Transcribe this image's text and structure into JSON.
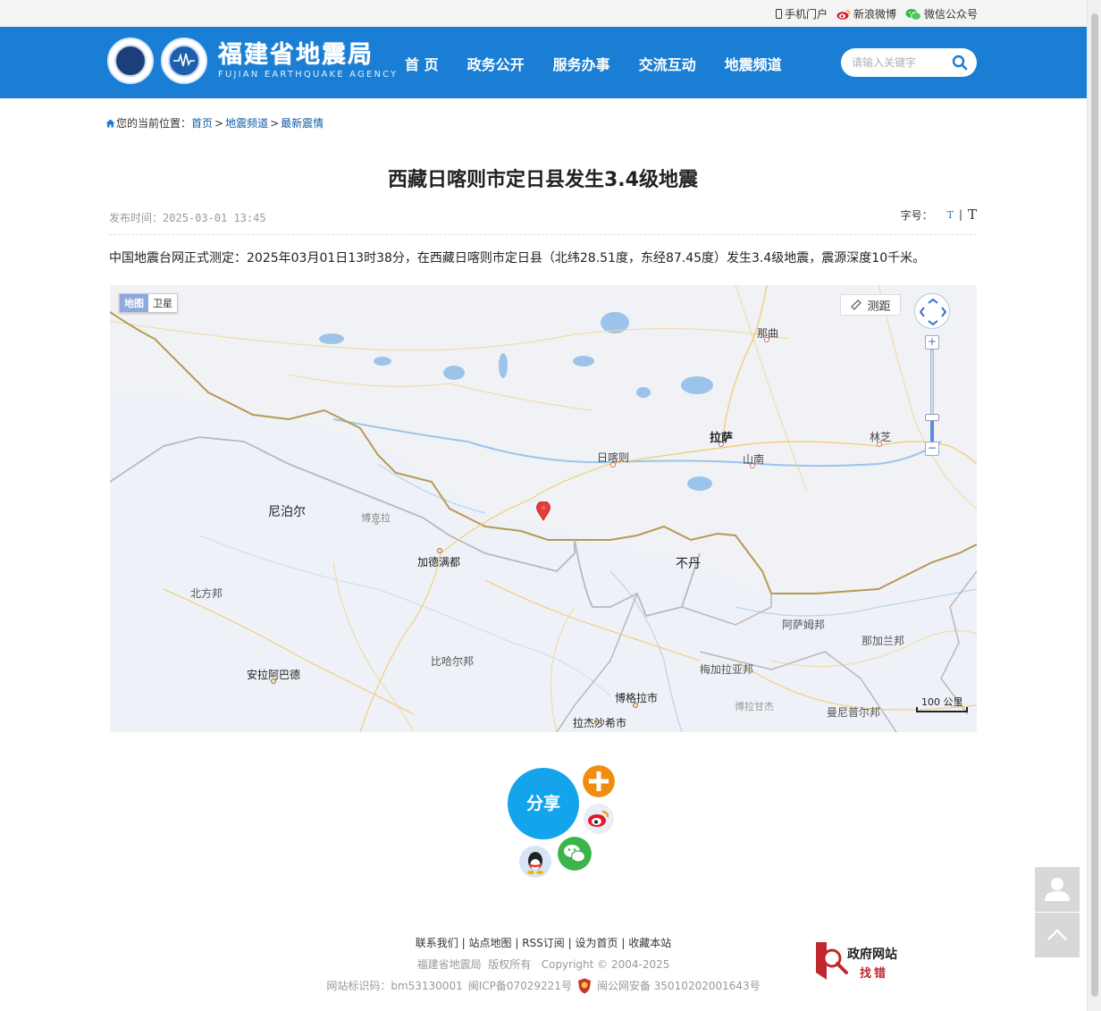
{
  "topbar": {
    "mobile": "手机门户",
    "weibo": "新浪微博",
    "wechat": "微信公众号"
  },
  "header": {
    "logo_cn": "福建省地震局",
    "logo_en": "FUJIAN EARTHQUAKE AGENCY",
    "nav": [
      "首 页",
      "政务公开",
      "服务办事",
      "交流互动",
      "地震频道"
    ],
    "search_placeholder": "请输入关键字"
  },
  "breadcrumb": {
    "prefix": "您的当前位置：",
    "items": [
      "首页",
      "地震频道",
      "最新震情"
    ],
    "sep": ">"
  },
  "article": {
    "title": "西藏日喀则市定日县发生3.4级地震",
    "publish_label": "发布时间：",
    "publish_time": "2025-03-01 13:45",
    "fontsize_label": "字号：",
    "fontsize_small": "T",
    "fontsize_sep": "|",
    "fontsize_big": "T",
    "body": "中国地震台网正式测定：2025年03月01日13时38分，在西藏日喀则市定日县（北纬28.51度，东经87.45度）发生3.4级地震，震源深度10千米。"
  },
  "map": {
    "type_map": "地图",
    "type_satellite": "卫星",
    "ranging": "测距",
    "scale": "100 公里",
    "labels": {
      "naqu": "那曲",
      "lhasa": "拉萨",
      "nyingchi": "林芝",
      "shigatse": "日喀则",
      "shannan": "山南",
      "nepal": "尼泊尔",
      "pokhara": "博克拉",
      "kathmandu": "加德满都",
      "bhutan": "不丹",
      "north_region": "北方邦",
      "assam": "阿萨姆邦",
      "nagaland": "那加兰邦",
      "allahabad": "安拉阿巴德",
      "bihar": "比哈尔邦",
      "meghalaya": "梅加拉亚邦",
      "bogra": "博格拉市",
      "bogra2": "博拉甘杰",
      "imphal": "曼尼普尔邦",
      "rajshahi": "拉杰沙希市"
    }
  },
  "share": {
    "label": "分享"
  },
  "footer": {
    "links": [
      "联系我们",
      "站点地图",
      "RSS订阅",
      "设为首页",
      "收藏本站"
    ],
    "link_sep": "|",
    "copyright_org": "福建省地震局",
    "copyright_rights": "版权所有",
    "copyright_years": "Copyright © 2004-2025",
    "site_code": "网站标识码：bm53130001",
    "icp": "闽ICP备07029221号",
    "police": "闽公网安备 35010202001643号",
    "govfix_title": "政府网站",
    "govfix_sub": "找错"
  },
  "colors": {
    "header_blue": "#1a7fd4",
    "share_blue": "#14a4ec",
    "link_blue": "#0f5da8"
  }
}
